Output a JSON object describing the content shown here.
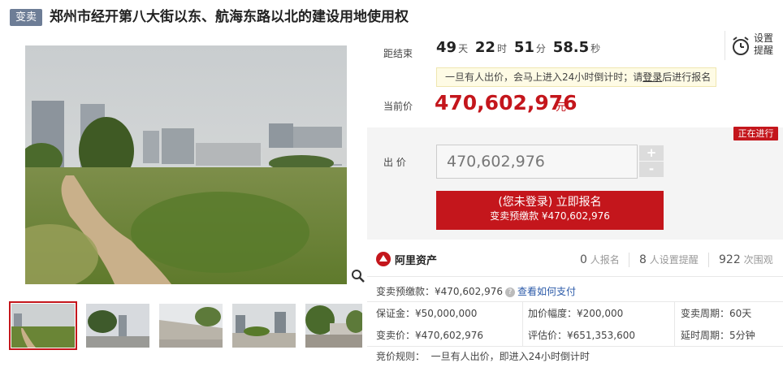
{
  "title": {
    "tag": "变卖",
    "text": "郑州市经开第八大街以东、航海东路以北的建设用地使用权"
  },
  "countdown": {
    "label": "距结束",
    "days": "49",
    "days_unit": "天",
    "hours": "22",
    "hours_unit": "时",
    "minutes": "51",
    "minutes_unit": "分",
    "seconds": "58.5",
    "seconds_unit": "秒"
  },
  "notice": {
    "text": "一旦有人出价，会马上进入24小时倒计时；请",
    "login_link": "登录",
    "text_after": "后进行报名"
  },
  "current_price": {
    "label": "当前价",
    "value": "470,602,976",
    "unit": "元"
  },
  "remind": {
    "line1": "设置",
    "line2": "提醒"
  },
  "status_badge": "正在进行",
  "bid": {
    "label": "出 价",
    "value": "470,602,976",
    "plus": "+",
    "minus": "-"
  },
  "signup_button": {
    "line1": "(您未登录) 立即报名",
    "line2": "变卖预缴款 ¥470,602,976"
  },
  "platform": {
    "name": "阿里资产"
  },
  "stats": {
    "signups": "0",
    "signups_label": "人报名",
    "reminders": "8",
    "reminders_label": "人设置提醒",
    "views": "922",
    "views_label": "次围观"
  },
  "deposit": {
    "label": "变卖预缴款：¥470,602,976",
    "help_link": "查看如何支付"
  },
  "details": {
    "bond": "保证金：¥50,000,000",
    "increment": "加价幅度：¥200,000",
    "period": "变卖周期：60天",
    "sale_price": "变卖价：¥470,602,976",
    "appraisal": "评估价：¥651,353,600",
    "delay": "延时周期：5分钟",
    "rule": "竞价规则：  一旦有人出价，即进入24小时倒计时"
  },
  "colors": {
    "accent": "#c4161c",
    "tag_bg": "#6d7d96",
    "link": "#2b5aa8"
  },
  "icons": [
    "zoom-icon",
    "alarm-clock-icon",
    "question-icon",
    "ali-logo-icon"
  ]
}
